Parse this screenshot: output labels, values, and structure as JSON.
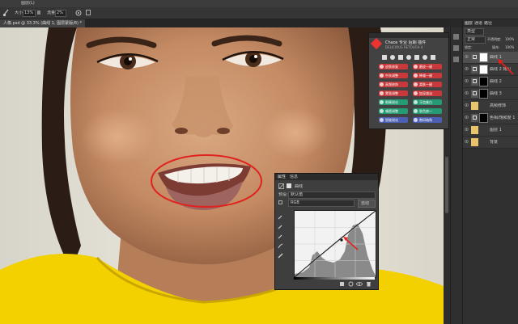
{
  "app": {
    "menu_title": "图层(L)",
    "doc_tab": "人像.psd @ 33.3% (曲线 1, 图层蒙版/8) *"
  },
  "options": {
    "size_label": "大小:",
    "size_value": "13%",
    "flow_label": "流量:",
    "flow_value": "2%",
    "mode_label": "模式:",
    "mode_value": "正常"
  },
  "plugin": {
    "title": "Chaos 专业 后期 插件",
    "subtitle": "DELICIOUS RETOUCH 4",
    "buttons": [
      {
        "label": "皮肤修复",
        "color": "#c9383a"
      },
      {
        "label": "磨皮一键",
        "color": "#c9383a"
      },
      {
        "label": "中灰调整",
        "color": "#c9383a"
      },
      {
        "label": "降噪一键",
        "color": "#c9383a"
      },
      {
        "label": "高频修饰",
        "color": "#c9383a"
      },
      {
        "label": "柔肤一键",
        "color": "#c9383a"
      },
      {
        "label": "蒙版调整",
        "color": "#c9383a"
      },
      {
        "label": "加深减淡",
        "color": "#c9383a"
      },
      {
        "label": "眼睛锐化",
        "color": "#259a75"
      },
      {
        "label": "牙齿美白",
        "color": "#259a75"
      },
      {
        "label": "嘴唇调整",
        "color": "#259a75"
      },
      {
        "label": "肤色统一",
        "color": "#259a75"
      },
      {
        "label": "智能锐化",
        "color": "#4b5fb4"
      },
      {
        "label": "数码暗角",
        "color": "#4b5fb4"
      }
    ]
  },
  "properties": {
    "tabs": [
      "属性",
      "信息"
    ],
    "section": "曲线",
    "preset_label": "预设:",
    "preset_value": "默认值",
    "channel_value": "RGB",
    "auto_label": "自动",
    "curve_points": [
      [
        0,
        0
      ],
      [
        0.58,
        0.56
      ],
      [
        1,
        1
      ]
    ]
  },
  "layers": {
    "tabs": [
      "图层",
      "通道",
      "路径"
    ],
    "search_label": "类型",
    "blend_mode": "正常",
    "opacity_label": "不透明度:",
    "opacity_value": "100%",
    "lock_label": "锁定:",
    "fill_label": "填充:",
    "fill_value": "100%",
    "items": [
      {
        "name": "曲线 1",
        "type": "curves",
        "selected": true
      },
      {
        "name": "曲线 2 拷贝",
        "type": "mask-white"
      },
      {
        "name": "曲线 2",
        "type": "mask-black"
      },
      {
        "name": "曲线 3",
        "type": "mask-black"
      },
      {
        "name": "高频修饰",
        "type": "photo"
      },
      {
        "name": "色相/饱和度 1",
        "type": "mask-dark"
      },
      {
        "name": "图层 1",
        "type": "photo"
      },
      {
        "name": "背景",
        "type": "photo"
      }
    ]
  },
  "colors": {
    "annotation": "#e0211d",
    "shirt": "#f3d000"
  },
  "icons": [
    "brush-icon",
    "airbrush-icon",
    "eyedropper-icon",
    "pencil-icon",
    "curve-icon",
    "hand-icon",
    "visibility-icon",
    "trash-icon",
    "reset-icon",
    "link-icon"
  ]
}
